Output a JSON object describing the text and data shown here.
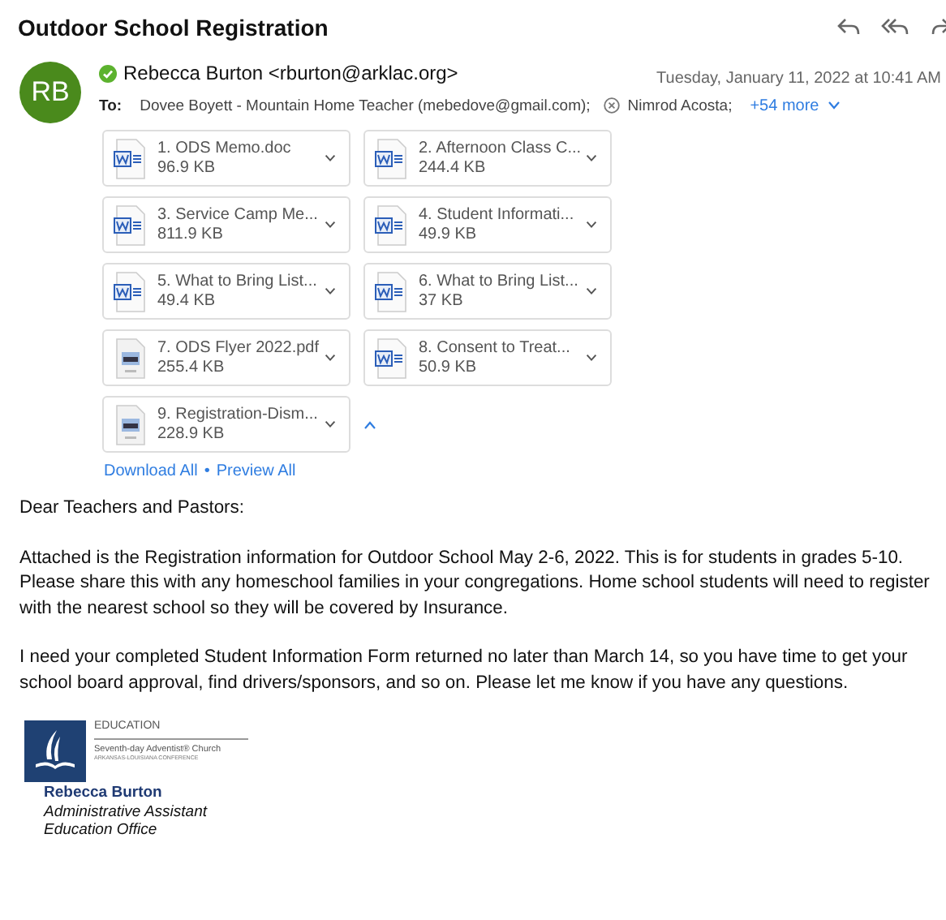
{
  "subject": "Outdoor School Registration",
  "sender": {
    "initials": "RB",
    "verified": true,
    "name": "Rebecca Burton <rburton@arklac.org>",
    "date": "Tuesday, January 11, 2022 at 10:41 AM"
  },
  "to": {
    "label": "To:",
    "recipients": [
      {
        "name": "Dovee Boyett - Mountain Home Teacher (mebedove@gmail.com);",
        "kind": "plain"
      },
      {
        "name": "Nimrod Acosta;",
        "kind": "removable"
      }
    ],
    "more": "+54 more"
  },
  "attachments": [
    {
      "name": "1. ODS Memo.doc",
      "size": "96.9 KB",
      "kind": "word"
    },
    {
      "name": "2. Afternoon Class C...",
      "size": "244.4 KB",
      "kind": "word"
    },
    {
      "name": "3. Service Camp Me...",
      "size": "811.9 KB",
      "kind": "word"
    },
    {
      "name": "4. Student Informati...",
      "size": "49.9 KB",
      "kind": "word"
    },
    {
      "name": "5. What to Bring List...",
      "size": "49.4 KB",
      "kind": "word"
    },
    {
      "name": "6. What to Bring List...",
      "size": "37 KB",
      "kind": "word"
    },
    {
      "name": "7. ODS Flyer 2022.pdf",
      "size": "255.4 KB",
      "kind": "pdf"
    },
    {
      "name": "8. Consent to Treat...",
      "size": "50.9 KB",
      "kind": "word"
    },
    {
      "name": "9. Registration-Dism...",
      "size": "228.9 KB",
      "kind": "pdf"
    }
  ],
  "expanded": true,
  "links": [
    "Download All",
    "Preview All"
  ],
  "link_separator": "•",
  "body": [
    "Dear Teachers and Pastors:",
    "Attached is the Registration information for Outdoor School May 2-6, 2022. This is for students in grades 5-10. Please share this with any homeschool families in your congregations. Home school students will need to register with the nearest school so they will be covered by Insurance.",
    "I need your completed Student Information Form returned no later than March 14, so you have time to get your school board approval, find drivers/sponsors, and so on. Please let me know if you have any questions."
  ],
  "signature": {
    "logo_texts": [
      "EDUCATION",
      "Seventh-day Adventist® Church",
      "ARKANSAS-LOUISIANA CONFERENCE"
    ],
    "name": "Rebecca Burton",
    "title": "Administrative Assistant",
    "office": "Education Office"
  }
}
